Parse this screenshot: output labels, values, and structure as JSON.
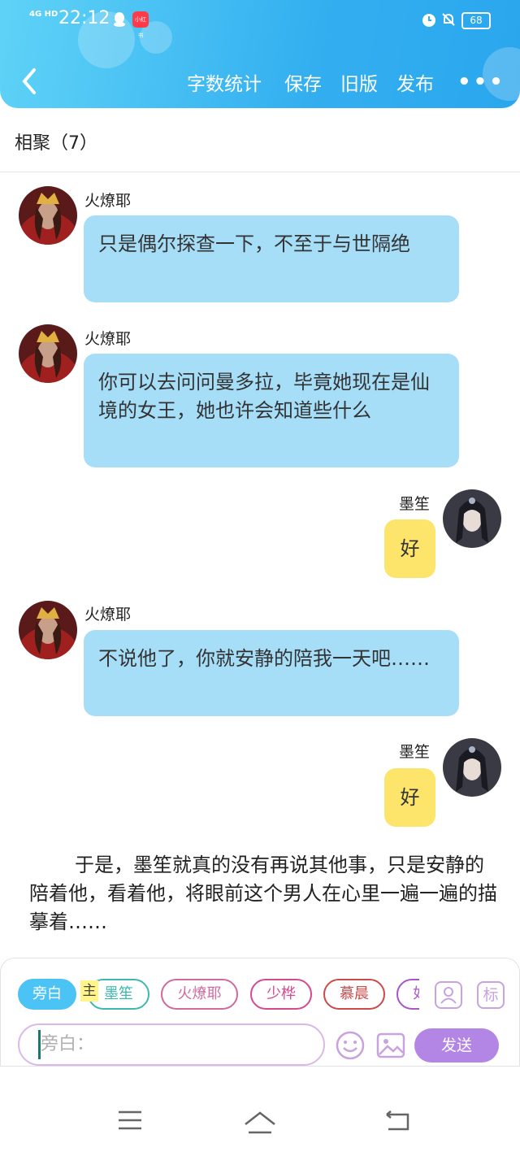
{
  "status_bar": {
    "network": "4G HD",
    "time": "22:12",
    "app_badge": "小红书",
    "battery": "68"
  },
  "toolbar": {
    "word_count": "字数统计",
    "save": "保存",
    "old_version": "旧版",
    "publish": "发布",
    "more": "•••"
  },
  "chapter_title": "相聚（7）",
  "messages": [
    {
      "sender": "火燎耶",
      "text": "只是偶尔探查一下，不至于与世隔绝"
    },
    {
      "sender": "火燎耶",
      "text": "你可以去问问曼多拉，毕竟她现在是仙境的女王，她也许会知道些什么"
    },
    {
      "sender": "墨笙",
      "text": "好"
    },
    {
      "sender": "火燎耶",
      "text": "不说他了，你就安静的陪我一天吧……"
    },
    {
      "sender": "墨笙",
      "text": "好"
    }
  ],
  "narration": "于是，墨笙就真的没有再说其他事，只是安静的陪着他，看着他，将眼前这个男人在心里一遍一遍的描摹着……",
  "roles": {
    "main_tag": "主",
    "chips": [
      "旁白",
      "墨笙",
      "火燎耶",
      "少桦",
      "慕晨",
      "如"
    ],
    "colors": {
      "旁白": "#4cc3f5",
      "墨笙": "#3cb8b0",
      "火燎耶": "#d06a9e",
      "少桦": "#d44a8e",
      "慕晨": "#cc4a4a",
      "如": "#a855c8"
    },
    "tag_button": "标"
  },
  "composer": {
    "placeholder": "旁白：",
    "send": "发送"
  }
}
